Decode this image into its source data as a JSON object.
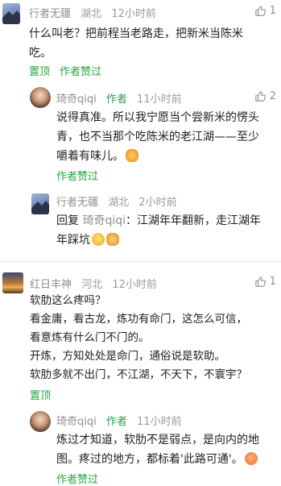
{
  "c1": {
    "user": "行者无疆",
    "location": "湖北",
    "time": "12小时前",
    "likes": "1",
    "lines": [
      "什么叫老？把前程当老路走，把新米当陈米",
      "吃。"
    ],
    "actions": [
      "置顶",
      "作者赞过"
    ]
  },
  "r1": {
    "user": "琦奇qiqi",
    "badge": "作者",
    "time": "11小时前",
    "likes": "2",
    "lines": [
      "说得真准。所以我宁愿当个尝新米的愣头",
      "青，也不当那个吃陈米的老江湖——至少",
      "嚼着有味儿。"
    ],
    "actions": [
      "作者赞过"
    ]
  },
  "r2": {
    "user": "行者无疆",
    "location": "湖北",
    "time": "2小时前",
    "reply_prefix": "回复",
    "reply_to": "琦奇qiqi",
    "lines_after": [
      "：江湖年年翻新，走江湖年",
      "年踩坑"
    ]
  },
  "c2": {
    "user": "红日丰神",
    "location": "河北",
    "time": "12小时前",
    "likes": "1",
    "lines": [
      "软肋这么疼吗？",
      "看金庸，看古龙，炼功有命门，这怎么可信，",
      "看意炼有什么门不门的。",
      "开炼，方知处处是命门，通俗说是软助。",
      "软肋多就不出门，不江湖，不天下，不寰宇？"
    ],
    "actions": [
      "置顶"
    ]
  },
  "r3": {
    "user": "琦奇qiqi",
    "badge": "作者",
    "time": "11小时前",
    "lines": [
      "炼过才知道，软肋不是弱点，是向内的地",
      "图。疼过的地方，都标着'此路可通'。"
    ],
    "actions": [
      "作者赞过"
    ]
  }
}
